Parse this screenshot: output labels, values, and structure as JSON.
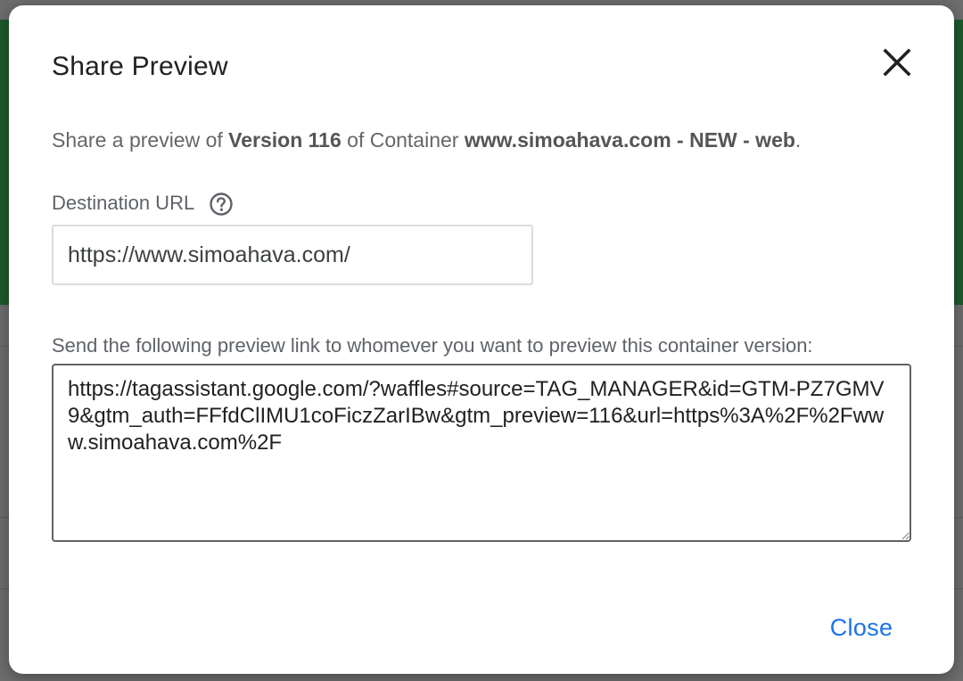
{
  "dialog": {
    "title": "Share Preview",
    "description": {
      "prefix": "Share a preview of ",
      "version": "Version 116",
      "middle": " of Container ",
      "container": "www.simoahava.com - NEW - web",
      "suffix": "."
    },
    "destination": {
      "label": "Destination URL",
      "value": "https://www.simoahava.com/"
    },
    "preview_link": {
      "label": "Send the following preview link to whomever you want to preview this container version:",
      "value": "https://tagassistant.google.com/?waffles#source=TAG_MANAGER&id=GTM-PZ7GMV9&gtm_auth=FFfdClIMU1coFiczZarIBw&gtm_preview=116&url=https%3A%2F%2Fwww.simoahava.com%2F"
    },
    "close_label": "Close"
  },
  "colors": {
    "accent": "#1a73e8",
    "title": "#212121",
    "muted": "#5f6368"
  },
  "icons": {
    "close": "close-icon",
    "help": "help-icon"
  }
}
